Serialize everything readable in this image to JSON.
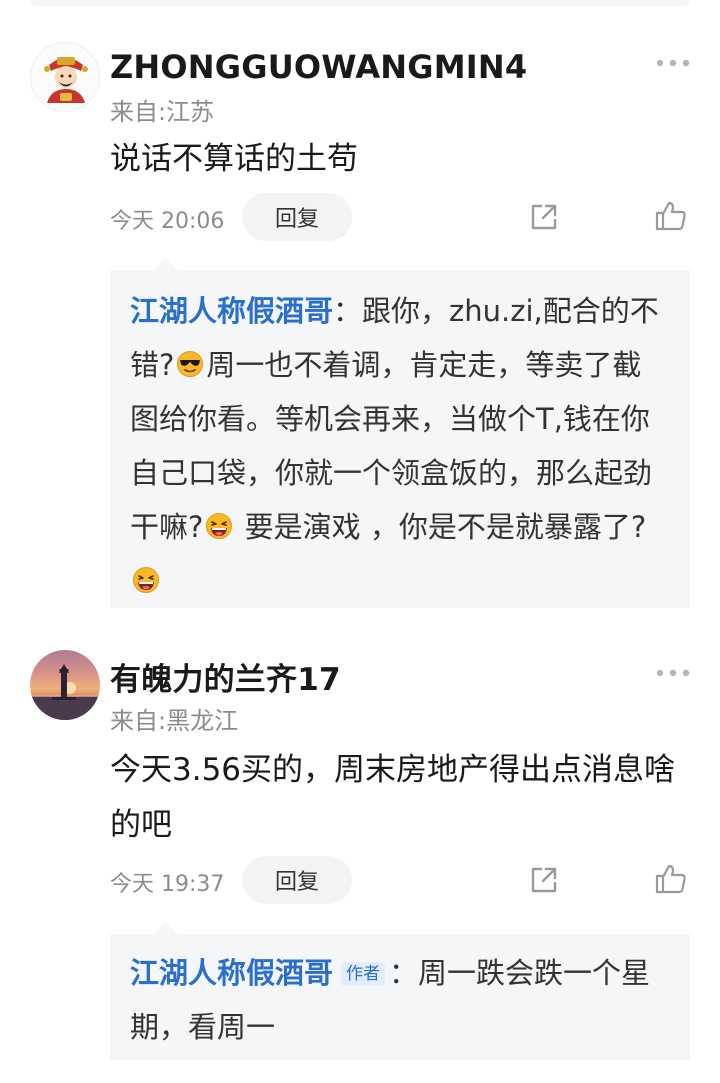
{
  "comments": [
    {
      "username": "ZHONGGUOWANGMIN4",
      "location": "来自:江苏",
      "content": "说话不算话的土苟",
      "time": "今天 20:06",
      "reply_label": "回复",
      "reply": {
        "author": "江湖人称假酒哥",
        "separator": "：",
        "segments": [
          "跟你，zhu.zi,配合的不错?",
          "周一也不着调，肯定走，等卖了截图给你看。等机会再来，当做个T,钱在你自己口袋，你就一个领盒饭的，那么起劲干嘛?",
          "  要是演戏 ，你是不是就暴露了?"
        ],
        "emojis": [
          "sunglasses-emoji",
          "laughing-emoji",
          "laughing-emoji"
        ]
      }
    },
    {
      "username": "有魄力的兰齐17",
      "location": "来自:黑龙江",
      "content": "今天3.56买的，周末房地产得出点消息啥的吧",
      "time": "今天 19:37",
      "reply_label": "回复",
      "reply": {
        "author": "江湖人称假酒哥",
        "badge": "作者",
        "separator": "：",
        "text": "周一跌会跌一个星期，看周一"
      }
    }
  ],
  "icons": [
    "more-icon",
    "share-icon",
    "like-icon"
  ],
  "colors": {
    "author_link": "#2a6fcf",
    "reply_bg": "#f5f6f8",
    "meta_gray": "#8c8c8c"
  }
}
